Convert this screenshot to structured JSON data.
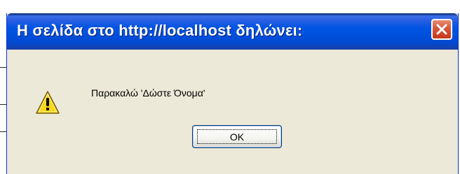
{
  "dialog": {
    "title": "Η σελίδα στο http://localhost δηλώνει:",
    "message": "Παρακαλώ 'Δώστε Όνομα'",
    "ok_label": "OK",
    "icon": "warning-icon",
    "close_icon": "close-icon"
  },
  "colors": {
    "titlebar": "#0054e3",
    "dialog_bg": "#ece9d8",
    "close_button": "#d9553a",
    "warning_yellow": "#f8d81a"
  }
}
